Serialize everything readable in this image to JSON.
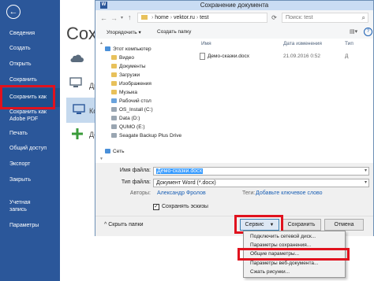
{
  "backstage": {
    "back_glyph": "←",
    "title": "Сохран",
    "items": [
      {
        "label": "Сведения"
      },
      {
        "label": "Создать"
      },
      {
        "label": "Открыть"
      },
      {
        "label": "Сохранить"
      },
      {
        "label": "Сохранить как"
      },
      {
        "label": "Сохранить как Adobe PDF"
      },
      {
        "label": "Печать"
      },
      {
        "label": "Общий доступ"
      },
      {
        "label": "Экспорт"
      },
      {
        "label": "Закрыть"
      },
      {
        "label": "Учетная запись"
      },
      {
        "label": "Параметры"
      }
    ],
    "partial": {
      "row1": "Др",
      "row2": "Ко",
      "row3": "До"
    }
  },
  "dialog": {
    "title": "Сохранение документа",
    "breadcrumb": [
      "home",
      "vektor.ru",
      "test"
    ],
    "search_placeholder": "Поиск: test",
    "toolbar": {
      "organize": "Упорядочить",
      "new_folder": "Создать папку"
    },
    "nav": [
      {
        "label": "Этот компьютер",
        "icon": "computer-icon"
      },
      {
        "label": "Видео",
        "icon": "video-folder-icon"
      },
      {
        "label": "Документы",
        "icon": "documents-folder-icon"
      },
      {
        "label": "Загрузки",
        "icon": "downloads-folder-icon"
      },
      {
        "label": "Изображения",
        "icon": "pictures-folder-icon"
      },
      {
        "label": "Музыка",
        "icon": "music-folder-icon"
      },
      {
        "label": "Рабочий стол",
        "icon": "desktop-folder-icon"
      },
      {
        "label": "OS_Install (C:)",
        "icon": "drive-icon"
      },
      {
        "label": "Data (D:)",
        "icon": "drive-icon"
      },
      {
        "label": "QUMO (E:)",
        "icon": "drive-icon"
      },
      {
        "label": "Seagate Backup Plus Drive",
        "icon": "drive-icon"
      },
      {
        "label": "Сеть",
        "icon": "network-icon"
      }
    ],
    "columns": {
      "name": "Имя",
      "date": "Дата изменения",
      "type": "Тип"
    },
    "files": [
      {
        "name": "Демо-сказки.docx",
        "date": "21.09.2016 0:52",
        "type": "Д"
      }
    ],
    "form": {
      "filename_label": "Имя файла:",
      "filename_value": "Демо-сказки.docx",
      "filetype_label": "Тип файла:",
      "filetype_value": "Документ Word (*.docx)",
      "authors_label": "Авторы:",
      "authors_value": "Александр Фролов",
      "tags_label": "Теги:",
      "tags_value": "Добавьте ключевое слово",
      "thumbnails_label": "Сохранять эскизы"
    },
    "hide_folders": "Скрыть папки",
    "service_button": "Сервис",
    "save_button": "Сохранить",
    "cancel_button": "Отмена",
    "service_menu": [
      "Подключить сетевой диск...",
      "Параметры сохранения...",
      "Общие параметры...",
      "Параметры веб-документа...",
      "Сжать рисунки..."
    ]
  },
  "colors": {
    "word_blue": "#2b579a",
    "highlight_red": "#e0121e",
    "select_blue": "#3399ff"
  }
}
